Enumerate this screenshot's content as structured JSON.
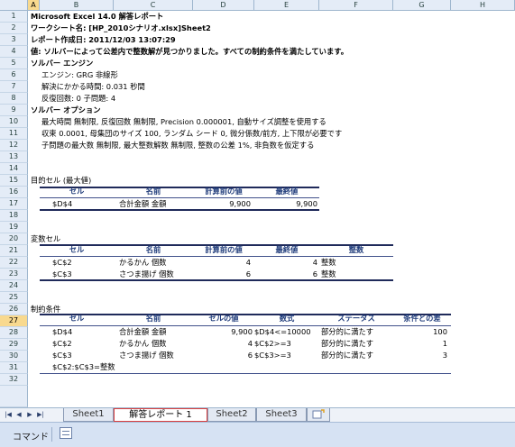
{
  "columns": [
    "A",
    "B",
    "C",
    "D",
    "E",
    "F",
    "G",
    "H"
  ],
  "rows": [
    "1",
    "2",
    "3",
    "4",
    "5",
    "6",
    "7",
    "8",
    "9",
    "10",
    "11",
    "12",
    "13",
    "14",
    "15",
    "16",
    "17",
    "18",
    "19",
    "20",
    "21",
    "22",
    "23",
    "24",
    "25",
    "26",
    "27",
    "28",
    "29",
    "30",
    "31",
    "32"
  ],
  "report": {
    "r1": "Microsoft Excel 14.0 解答レポート",
    "r2": "ワークシート名: [HP_2010シナリオ.xlsx]Sheet2",
    "r3": "レポート作成日: 2011/12/03 13:07:29",
    "r4": "値: ソルバーによって公差内で整数解が見つかりました。すべての制約条件を満たしています。",
    "r5": "ソルバー エンジン",
    "r6": "エンジン: GRG 非線形",
    "r7": "解決にかかる時間: 0.031 秒間",
    "r8": "反復回数: 0 子問題: 4",
    "r9": "ソルバー オプション",
    "r10": "最大時間 無制限, 反復回数 無制限, Precision 0.000001, 自動サイズ調整を使用する",
    "r11": "収束 0.0001, 母集団のサイズ 100, ランダム シード 0, 微分係数/前方, 上下限が必要です",
    "r12": "子問題の最大数 無制限, 最大整数解数 無制限, 整数の公差 1%, 非負数を仮定する"
  },
  "objective": {
    "title": "目的セル (最大値)",
    "headers": [
      "セル",
      "名前",
      "計算前の値",
      "最終値"
    ],
    "row": [
      "$D$4",
      "合計金額 金額",
      "9,900",
      "9,900"
    ]
  },
  "variables": {
    "title": "変数セル",
    "headers": [
      "セル",
      "名前",
      "計算前の値",
      "最終値",
      "整数"
    ],
    "rows": [
      [
        "$C$2",
        "かるかん 個数",
        "4",
        "4",
        "整数"
      ],
      [
        "$C$3",
        "さつま揚げ 個数",
        "6",
        "6",
        "整数"
      ]
    ]
  },
  "constraints": {
    "title": "制約条件",
    "headers": [
      "セル",
      "名前",
      "セルの値",
      "数式",
      "ステータス",
      "条件との差"
    ],
    "rows": [
      [
        "$D$4",
        "合計金額 金額",
        "9,900",
        "$D$4<=10000",
        "部分的に満たす",
        "100"
      ],
      [
        "$C$2",
        "かるかん 個数",
        "4",
        "$C$2>=3",
        "部分的に満たす",
        "1"
      ],
      [
        "$C$3",
        "さつま揚げ 個数",
        "6",
        "$C$3>=3",
        "部分的に満たす",
        "3"
      ]
    ],
    "note": "$C$2:$C$3=整数"
  },
  "tabs": {
    "sheet1": "Sheet1",
    "report": "解答レポート 1",
    "sheet2": "Sheet2",
    "sheet3": "Sheet3"
  },
  "status": {
    "mode": "コマンド"
  },
  "selected_row": "27",
  "selected_col": "A"
}
